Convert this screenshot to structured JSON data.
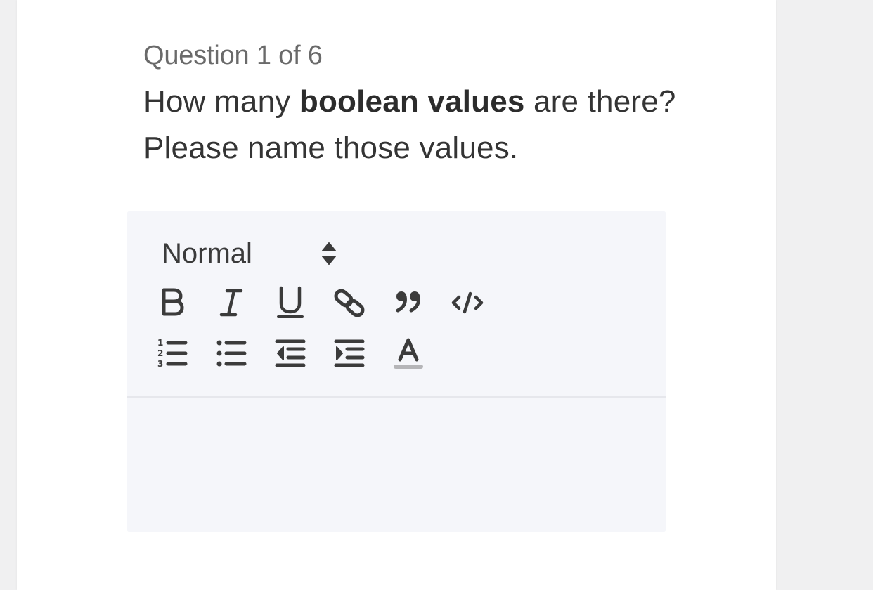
{
  "question": {
    "counter": "Question 1 of 6",
    "text_before": "How many ",
    "text_bold": "boolean values",
    "text_after": " are there? Please name those values."
  },
  "editor": {
    "format_value": "Normal",
    "toolbar_icons": [
      "bold-icon",
      "italic-icon",
      "underline-icon",
      "link-icon",
      "blockquote-icon",
      "code-icon",
      "ordered-list-icon",
      "bullet-list-icon",
      "outdent-icon",
      "indent-icon",
      "text-color-icon"
    ],
    "answer_text": "",
    "colors": {
      "icon": "#3b3b3b",
      "text_color_bar": "#b5b5b8",
      "editor_bg": "#f5f6fa"
    }
  }
}
